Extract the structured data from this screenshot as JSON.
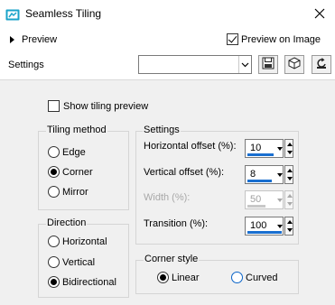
{
  "window": {
    "title": "Seamless Tiling",
    "app_icon": "tiling-app-icon",
    "close_icon": "close-icon"
  },
  "preview": {
    "label": "Preview",
    "preview_on_image_label": "Preview on Image",
    "preview_on_image_checked": true
  },
  "settings_bar": {
    "label": "Settings",
    "preset_value": "",
    "tools": [
      "save-preset-icon",
      "preset-cube-icon",
      "reset-icon"
    ]
  },
  "show_tiling_preview": {
    "label": "Show tiling preview",
    "checked": false
  },
  "tiling_method": {
    "title": "Tiling method",
    "options": [
      "Edge",
      "Corner",
      "Mirror"
    ],
    "selected": "Corner"
  },
  "direction": {
    "title": "Direction",
    "options": [
      "Horizontal",
      "Vertical",
      "Bidirectional"
    ],
    "selected": "Bidirectional"
  },
  "settings_group": {
    "title": "Settings",
    "fields": [
      {
        "label": "Horizontal offset (%):",
        "value": "10",
        "enabled": true
      },
      {
        "label": "Vertical offset (%):",
        "value": "8",
        "enabled": true
      },
      {
        "label": "Width (%):",
        "value": "50",
        "enabled": false
      },
      {
        "label": "Transition (%):",
        "value": "100",
        "enabled": true
      }
    ]
  },
  "corner_style": {
    "title": "Corner style",
    "options": [
      "Linear",
      "Curved"
    ],
    "selected": "Linear"
  },
  "colors": {
    "panel_bg": "#f0f0f0",
    "accent": "#1a6fd0",
    "app_icon_color": "#1aa3c9"
  }
}
